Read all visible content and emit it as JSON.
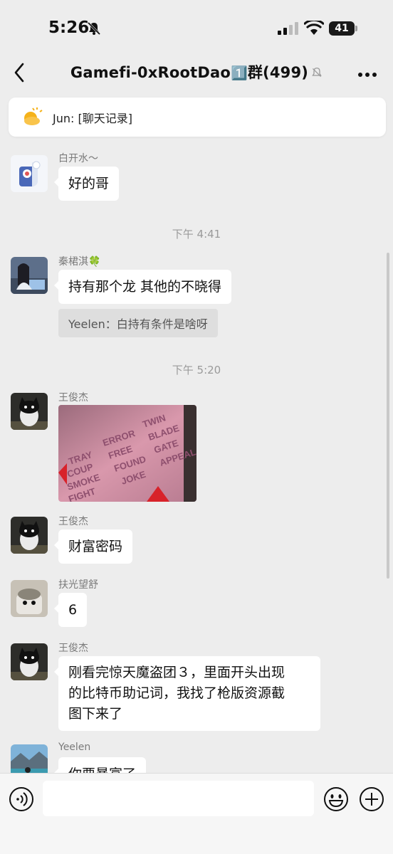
{
  "status_bar": {
    "time": "5:26",
    "battery": "41"
  },
  "nav": {
    "title": "Gamefi-0xRootDao",
    "title_suffix": "群(499)",
    "badge_glyph": "1️⃣"
  },
  "pinned": {
    "text": "Jun: [聊天记录]"
  },
  "messages": [
    {
      "sender": "白开水～",
      "text": "好的哥"
    },
    {
      "timestamp": "下午 4:41"
    },
    {
      "sender": "秦桾淇🍀",
      "text": "持有那个龙  其他的不晓得",
      "quote": "Yeelen：白持有条件是啥呀"
    },
    {
      "timestamp": "下午 5:20"
    },
    {
      "sender": "王俊杰",
      "image_words": [
        "TRAY",
        "COUP",
        "SMOKE",
        "FIGHT",
        "ERROR",
        "FREE",
        "FOUND",
        "JOKE",
        "TWIN",
        "BLADE",
        "GATE",
        "APPEAL"
      ]
    },
    {
      "sender": "王俊杰",
      "text": "财富密码"
    },
    {
      "sender": "扶光望舒",
      "text": "6"
    },
    {
      "sender": "王俊杰",
      "text_lines": [
        "刚看完惊天魔盗团３，里面开头出现",
        "的比特币助记词，我找了枪版资源截",
        "图下来了"
      ]
    },
    {
      "sender": "Yeelen",
      "text": "你要暴富了"
    }
  ],
  "icons": [
    "bell-off-icon",
    "signal-icon",
    "wifi-icon",
    "battery-icon",
    "back-chevron-icon",
    "mute-bell-icon",
    "more-icon",
    "sun-icon",
    "voice-icon",
    "emoji-icon",
    "plus-icon"
  ],
  "colors": {
    "background": "#ededed",
    "bubble": "#ffffff",
    "quote_bg": "#dedede",
    "timestamp": "#9a9a9a"
  }
}
